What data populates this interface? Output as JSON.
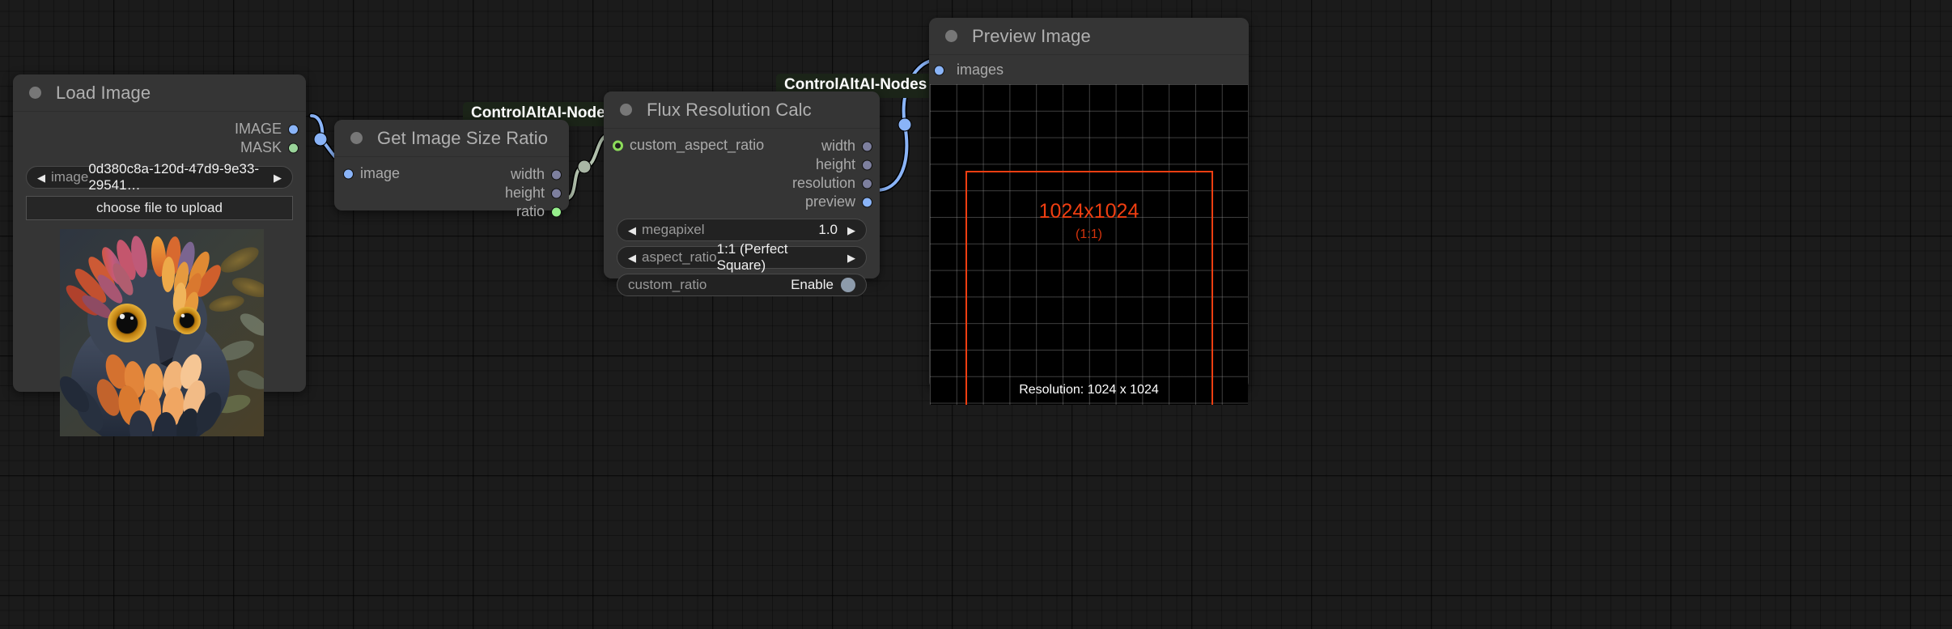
{
  "canvas": {
    "background_color": "#1b1b1b",
    "grid_color": "#000000"
  },
  "nodes": [
    {
      "id": "load-image",
      "title": "Load Image",
      "outputs": [
        {
          "name": "IMAGE",
          "type": "IMAGE",
          "color": "#8ab4f8"
        },
        {
          "name": "MASK",
          "type": "MASK",
          "color": "#9ad49a"
        }
      ],
      "widgets": [
        {
          "name": "image",
          "label": "image",
          "value": "0d380c8a-120d-47d9-9e33-29541…",
          "kind": "combo"
        },
        {
          "name": "upload",
          "label": "choose file to upload",
          "kind": "button"
        }
      ],
      "preview_alt": "fantasy owl with orange and blue feathers"
    },
    {
      "id": "get-image-size-ratio",
      "title": "Get Image Size Ratio",
      "badge": "ControlAltAI-Nodes",
      "inputs": [
        {
          "name": "image",
          "type": "IMAGE",
          "color": "#8ab4f8"
        }
      ],
      "outputs": [
        {
          "name": "width",
          "type": "INT",
          "color": "#7d7f9e"
        },
        {
          "name": "height",
          "type": "INT",
          "color": "#7d7f9e"
        },
        {
          "name": "ratio",
          "type": "RATIO",
          "color": "#96ee8c"
        }
      ]
    },
    {
      "id": "flux-resolution-calc",
      "title": "Flux Resolution Calc",
      "badge": "ControlAltAI-Nodes",
      "inputs": [
        {
          "name": "custom_aspect_ratio",
          "type": "RATIO",
          "color": "#8cdc5a"
        }
      ],
      "outputs": [
        {
          "name": "width",
          "type": "INT",
          "color": "#7d7f9e"
        },
        {
          "name": "height",
          "type": "INT",
          "color": "#7d7f9e"
        },
        {
          "name": "resolution",
          "type": "INT",
          "color": "#7d7f9e"
        },
        {
          "name": "preview",
          "type": "IMAGE",
          "color": "#8ab4f8"
        }
      ],
      "widgets": [
        {
          "name": "megapixel",
          "label": "megapixel",
          "value": "1.0",
          "kind": "number"
        },
        {
          "name": "aspect_ratio",
          "label": "aspect_ratio",
          "value": "1:1 (Perfect Square)",
          "kind": "combo"
        },
        {
          "name": "custom_ratio",
          "label": "custom_ratio",
          "value": "Enable",
          "kind": "toggle"
        }
      ]
    },
    {
      "id": "preview-image",
      "title": "Preview Image",
      "inputs": [
        {
          "name": "images",
          "type": "IMAGE",
          "color": "#8ab4f8"
        }
      ],
      "preview": {
        "resolution_text": "1024x1024",
        "ratio_text": "(1:1)",
        "footer_text": "Resolution: 1024 x 1024",
        "box_color": "#ef3e11",
        "background_color": "#000000"
      }
    }
  ],
  "links": [
    {
      "from": "load-image.IMAGE",
      "to": "get-image-size-ratio.image",
      "color": "#8ab4f8"
    },
    {
      "from": "get-image-size-ratio.ratio",
      "to": "flux-resolution-calc.custom_aspect_ratio",
      "color": "#b5c4b0"
    },
    {
      "from": "flux-resolution-calc.preview",
      "to": "preview-image.images",
      "color": "#8ab4f8"
    }
  ],
  "arrows": {
    "left": "◀",
    "right": "▶"
  }
}
